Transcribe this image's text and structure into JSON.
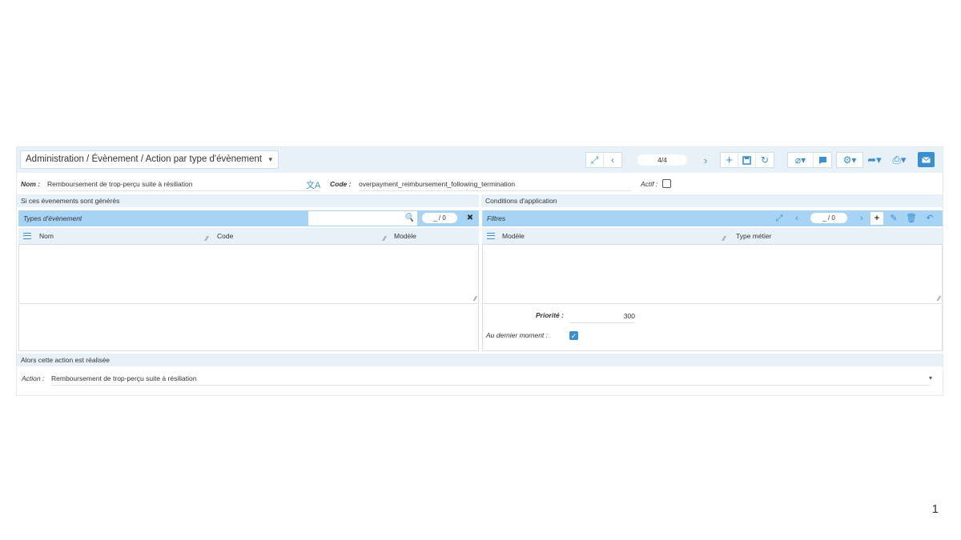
{
  "breadcrumb": "Administration / Évènement / Action par type d'évènement",
  "toolbar": {
    "pager": "4/4"
  },
  "header": {
    "nom_label": "Nom :",
    "nom_value": "Remboursement de trop-perçu suite à résiliation",
    "code_label": "Code :",
    "code_value": "overpayment_reimbursement_following_termination",
    "actif_label": "Actif :",
    "actif_checked": false
  },
  "left_section": {
    "title": "Si ces évenements sont générés",
    "panel_title": "Types d'évènement",
    "search_value": "",
    "pager": "_ / 0",
    "columns": [
      "Nom",
      "Code",
      "Modèle"
    ]
  },
  "right_section": {
    "title": "Conditions d'application",
    "panel_title": "Filtres",
    "pager": "_ / 0",
    "columns": [
      "Modèle",
      "Type métier"
    ],
    "priorite_label": "Priorité :",
    "priorite_value": "300",
    "dernier_label": "Au dernier moment :",
    "dernier_checked": true
  },
  "action_section": {
    "title": "Alors cette action est réalisée",
    "action_label": "Action :",
    "action_value": "Remboursement de trop-perçu suite à résiliation"
  },
  "page_number": "1",
  "colors": {
    "accent": "#3a8fd0",
    "panel_header": "#a7d4f5",
    "band": "#e8f1f8"
  }
}
